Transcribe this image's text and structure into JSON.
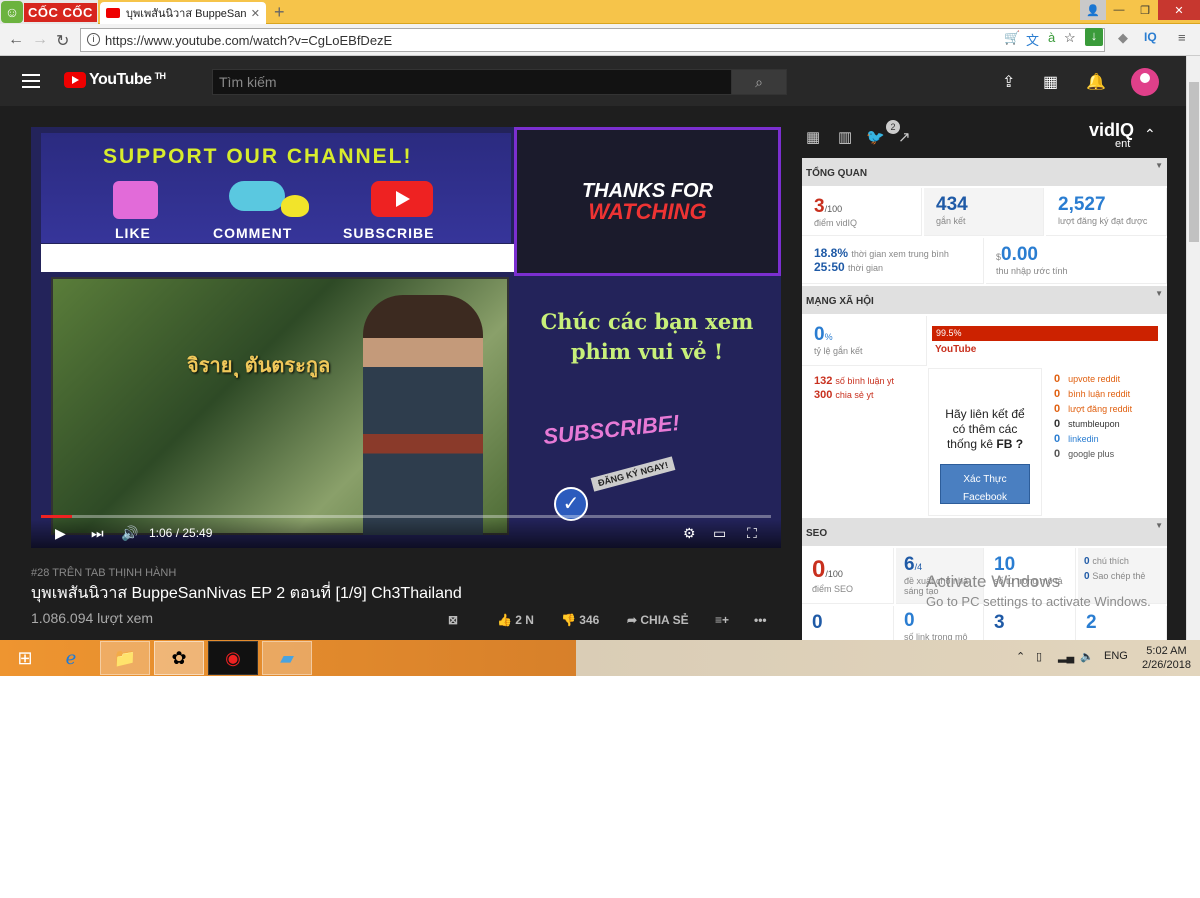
{
  "browser": {
    "logo_text": "CỐC CỐC",
    "tab_title": "บุพเพสันนิวาส BuppeSanNiv",
    "url": "https://www.youtube.com/watch?v=CgLoEBfDezE",
    "ext_iq": "IQ"
  },
  "youtube": {
    "logo": "YouTube",
    "region": "TH",
    "search_placeholder": "Tìm kiếm"
  },
  "video": {
    "support_text": "SUPPORT OUR CHANNEL!",
    "like_label": "LIKE",
    "comment_label": "COMMENT",
    "subscribe_label": "SUBSCRIBE",
    "thanks_line1": "THANKS FOR",
    "thanks_line2": "WATCHING",
    "name_overlay": "จิราย ุ ตันตระกูล",
    "greeting_line1": "Chúc các bạn xem",
    "greeting_line2": "phim vui vẻ !",
    "subscribe_overlay": "SUBSCRIBE!",
    "dangky": "ĐĂNG KÝ NGAY!",
    "time": "1:06 / 25:49",
    "progress_fraction": 0.042,
    "trending": "#28 TRÊN TAB THỊNH HÀNH",
    "title": "บุพเพสันนิวาส BuppeSanNivas EP 2 ตอนที่ [1/9] Ch3Thailand",
    "views": "1.086.094 lượt xem",
    "likes": "2 N",
    "dislikes": "346",
    "share": "CHIA SẺ"
  },
  "vidiq": {
    "logo": "vidIQ",
    "logo_sub": "ent",
    "twitter_badge": "2",
    "overview": {
      "header": "TỔNG QUAN",
      "score": "3",
      "score_suffix": "/100",
      "score_label": "điểm vidIQ",
      "engagement": "434",
      "engagement_label": "gắn kết",
      "subs": "2,527",
      "subs_label": "lượt đăng ký đạt được",
      "watch_pct": "18.8%",
      "watch_pct_label": "thời gian xem trung bình",
      "watch_time": "25:50",
      "watch_time_label": "thời gian",
      "earnings_currency": "$",
      "earnings": "0.00",
      "earnings_label": "thu nhập ước tính"
    },
    "social": {
      "header": "MẠNG XÃ HỘI",
      "engagement_rate": "0",
      "engagement_rate_suffix": "%",
      "engagement_rate_label": "tỷ lệ gắn kết",
      "yt_pct": "99.5%",
      "yt_label": "YouTube",
      "yt_comments": "132",
      "yt_comments_label": "số bình luận yt",
      "yt_shares": "300",
      "yt_shares_label": "chia sẻ yt",
      "fb_prompt_1": "Hãy liên kết để",
      "fb_prompt_2": "có thêm các",
      "fb_prompt_3": "thống kê",
      "fb_prompt_fb": "FB ?",
      "fb_button": "Xác Thực Facebook",
      "stats": [
        {
          "value": "0",
          "label": "upvote reddit",
          "color": "#e06010"
        },
        {
          "value": "0",
          "label": "bình luận reddit",
          "color": "#e06010"
        },
        {
          "value": "0",
          "label": "lượt đăng reddit",
          "color": "#e06010"
        },
        {
          "value": "0",
          "label": "stumbleupon",
          "color": "#333"
        },
        {
          "value": "0",
          "label": "linkedin",
          "color": "#2a7dd1"
        },
        {
          "value": "0",
          "label": "google plus",
          "color": "#555"
        }
      ]
    },
    "seo": {
      "header": "SEO",
      "score": "0",
      "score_suffix": "/100",
      "score_label": "điểm SEO",
      "suggest": "6",
      "suggest_suffix": "/4",
      "suggest_label": "đề xuất cho nhà sáng tạo",
      "keywords": "10",
      "keywords_label": "số từ trong mô tả",
      "favs": "0",
      "favs_label": "chú thích",
      "copies": "0",
      "copies_label": "Sao chép thẻ",
      "row2_a": "0",
      "row2_b": "0",
      "row2_b_label": "số link trong mô",
      "row2_c": "3",
      "row2_d": "2"
    }
  },
  "watermark": {
    "line1": "Activate Windows",
    "line2": "Go to PC settings to activate Windows."
  },
  "taskbar": {
    "lang": "ENG",
    "time": "5:02 AM",
    "date": "2/26/2018"
  }
}
